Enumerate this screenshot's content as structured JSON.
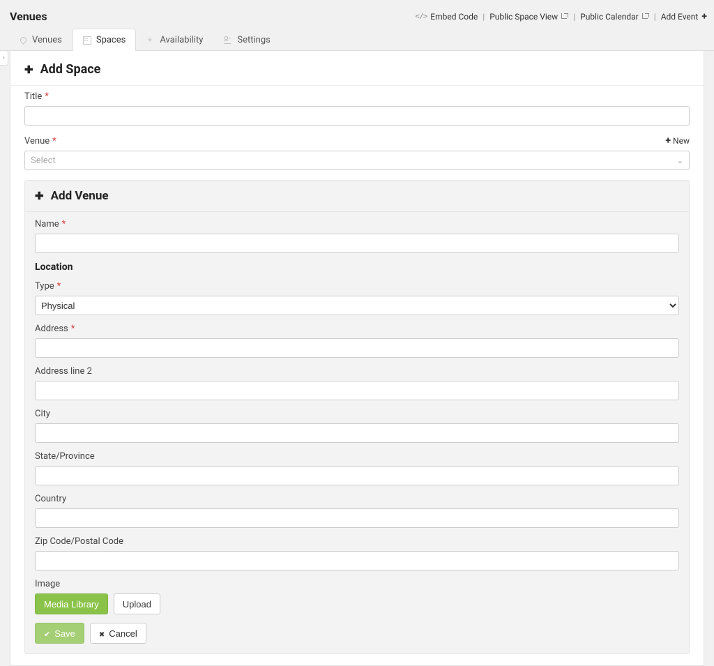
{
  "header": {
    "title": "Venues",
    "actions": {
      "embed": "Embed Code",
      "public_space": "Public Space View",
      "public_calendar": "Public Calendar",
      "add_event": "Add Event"
    }
  },
  "tabs": [
    {
      "id": "venues",
      "label": "Venues",
      "icon": "pin"
    },
    {
      "id": "spaces",
      "label": "Spaces",
      "icon": "building",
      "active": true
    },
    {
      "id": "availability",
      "label": "Availability",
      "icon": "spark"
    },
    {
      "id": "settings",
      "label": "Settings",
      "icon": "sliders"
    }
  ],
  "add_space": {
    "heading": "Add Space",
    "fields": {
      "title": {
        "label": "Title",
        "required": true,
        "value": ""
      },
      "venue": {
        "label": "Venue",
        "required": true,
        "placeholder": "Select",
        "new": "New"
      }
    }
  },
  "add_venue": {
    "heading": "Add Venue",
    "location_heading": "Location",
    "fields": {
      "name": {
        "label": "Name",
        "required": true,
        "value": ""
      },
      "type": {
        "label": "Type",
        "required": true,
        "value": "Physical",
        "options": [
          "Physical"
        ]
      },
      "address": {
        "label": "Address",
        "required": true,
        "value": ""
      },
      "address2": {
        "label": "Address line 2",
        "value": ""
      },
      "city": {
        "label": "City",
        "value": ""
      },
      "state": {
        "label": "State/Province",
        "value": ""
      },
      "country": {
        "label": "Country",
        "value": ""
      },
      "zip": {
        "label": "Zip Code/Postal Code",
        "value": ""
      },
      "image": {
        "label": "Image"
      }
    },
    "buttons": {
      "media_library": "Media Library",
      "upload": "Upload",
      "save": "Save",
      "cancel": "Cancel"
    }
  }
}
